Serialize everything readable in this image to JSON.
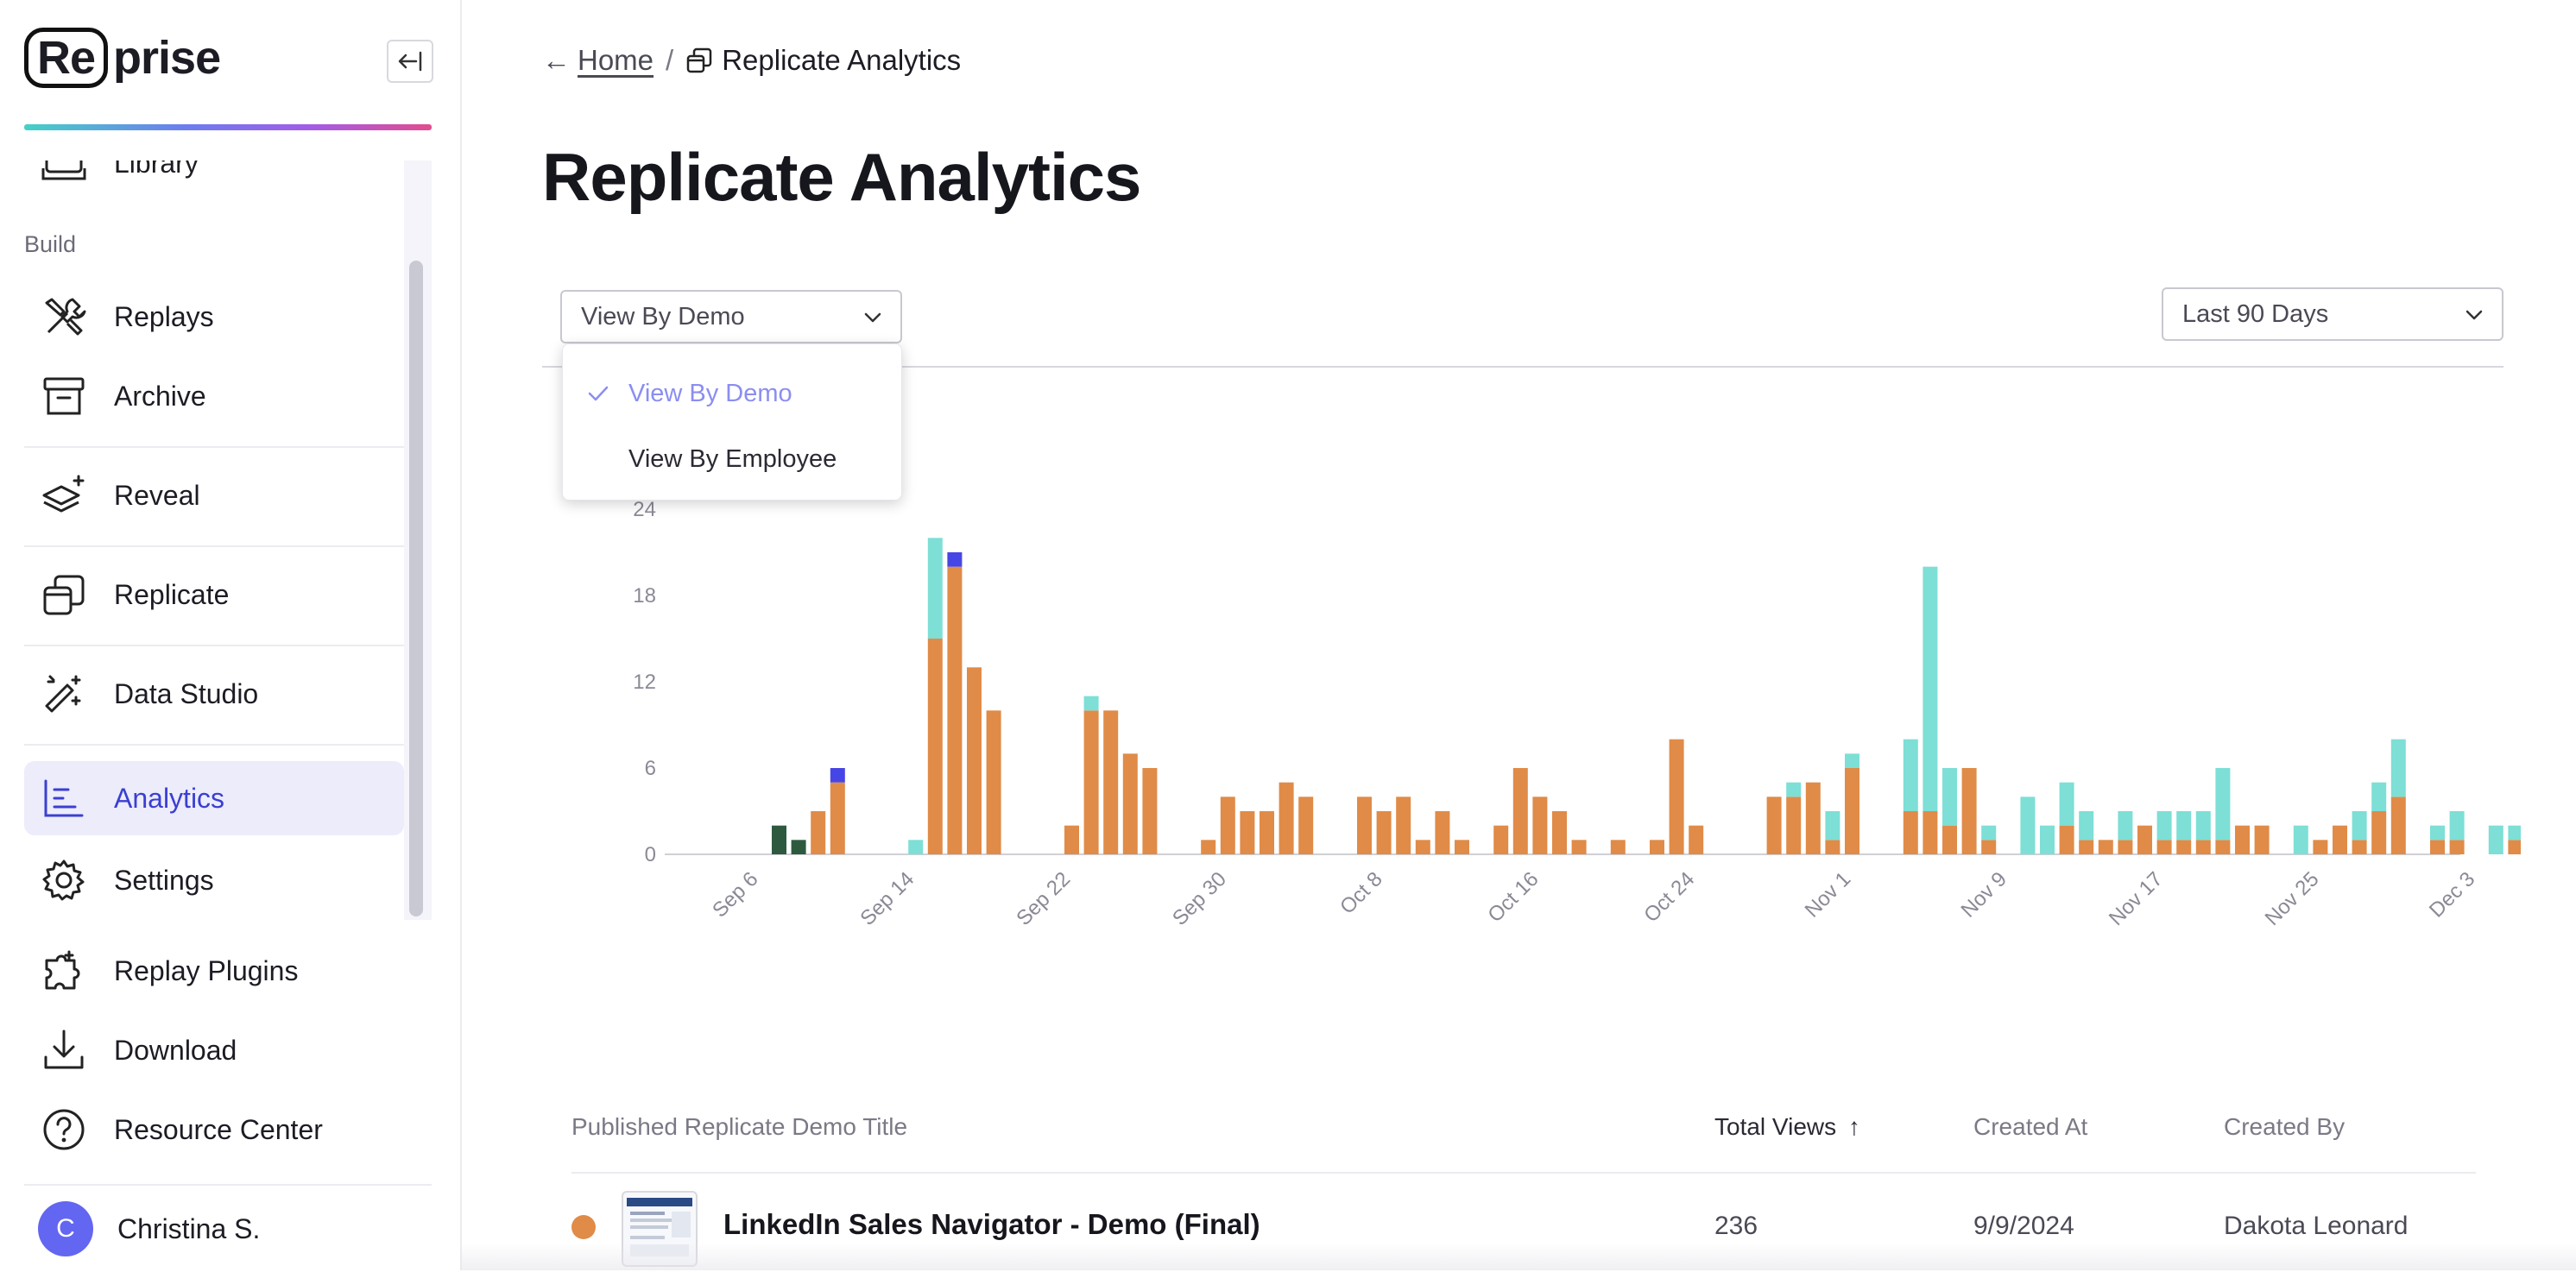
{
  "brand": {
    "logo_left": "Re",
    "logo_right": "prise"
  },
  "sidebar": {
    "partial_top_item": "Library",
    "section_build": "Build",
    "items": [
      {
        "label": "Replays",
        "icon": "tools-icon"
      },
      {
        "label": "Archive",
        "icon": "archive-icon"
      },
      {
        "label": "Reveal",
        "icon": "layers-sparkle-icon"
      },
      {
        "label": "Replicate",
        "icon": "copy-windows-icon"
      },
      {
        "label": "Data Studio",
        "icon": "magic-wand-icon"
      },
      {
        "label": "Analytics",
        "icon": "chart-icon",
        "active": true
      }
    ],
    "lower_items": [
      {
        "label": "Settings",
        "icon": "gear-icon"
      },
      {
        "label": "Replay Plugins",
        "icon": "puzzle-icon"
      },
      {
        "label": "Download",
        "icon": "download-icon"
      },
      {
        "label": "Resource Center",
        "icon": "help-circle-icon"
      }
    ],
    "user": {
      "initial": "C",
      "name": "Christina S."
    }
  },
  "breadcrumb": {
    "back_arrow": "←",
    "home": "Home",
    "separator": "/",
    "current": "Replicate Analytics"
  },
  "page_title": "Replicate Analytics",
  "filters": {
    "view_select": "View By Demo",
    "range_select": "Last 90 Days",
    "dropdown_options": [
      {
        "label": "View By Demo",
        "selected": true
      },
      {
        "label": "View By Employee",
        "selected": false
      }
    ]
  },
  "colors": {
    "orange": "#e08b48",
    "teal": "#7ddfd6",
    "dark_green": "#2d5a3f",
    "blue": "#4646e6",
    "accent": "#3b3fd1"
  },
  "chart_data": {
    "type": "bar",
    "stacked": true,
    "x_axis": "date",
    "x_ticks": [
      "Sep 6",
      "Sep 14",
      "Sep 22",
      "Sep 30",
      "Oct 8",
      "Oct 16",
      "Oct 24",
      "Nov 1",
      "Nov 9",
      "Nov 17",
      "Nov 25",
      "Dec 3"
    ],
    "y_ticks": [
      0,
      6,
      12,
      18,
      24
    ],
    "ylim": [
      0,
      24
    ],
    "start_date": "Sep 6",
    "series": [
      {
        "color": "#2d5a3f",
        "points": [
          [
            10,
            2
          ],
          [
            11,
            1
          ]
        ]
      },
      {
        "color": "#e08b48",
        "points": [
          [
            12,
            3
          ],
          [
            13,
            5
          ],
          [
            18,
            15
          ],
          [
            19,
            20
          ],
          [
            20,
            13
          ],
          [
            21,
            10
          ],
          [
            25,
            2
          ],
          [
            26,
            10
          ],
          [
            27,
            10
          ],
          [
            28,
            7
          ],
          [
            29,
            6
          ],
          [
            32,
            1
          ],
          [
            33,
            4
          ],
          [
            34,
            3
          ],
          [
            35,
            3
          ],
          [
            36,
            5
          ],
          [
            37,
            4
          ],
          [
            40,
            4
          ],
          [
            41,
            3
          ],
          [
            42,
            4
          ],
          [
            43,
            1
          ],
          [
            44,
            3
          ],
          [
            45,
            1
          ],
          [
            47,
            2
          ],
          [
            48,
            6
          ],
          [
            49,
            4
          ],
          [
            50,
            3
          ],
          [
            51,
            1
          ],
          [
            53,
            1
          ],
          [
            55,
            1
          ],
          [
            56,
            8
          ],
          [
            57,
            2
          ],
          [
            61,
            4
          ],
          [
            62,
            4
          ],
          [
            63,
            5
          ],
          [
            64,
            1
          ],
          [
            65,
            6
          ],
          [
            68,
            3
          ],
          [
            69,
            3
          ],
          [
            70,
            2
          ],
          [
            71,
            6
          ],
          [
            72,
            1
          ],
          [
            76,
            2
          ],
          [
            77,
            1
          ],
          [
            78,
            1
          ],
          [
            79,
            1
          ],
          [
            80,
            2
          ],
          [
            81,
            1
          ],
          [
            82,
            1
          ],
          [
            83,
            1
          ],
          [
            84,
            1
          ],
          [
            85,
            2
          ],
          [
            86,
            2
          ],
          [
            89,
            1
          ],
          [
            90,
            2
          ],
          [
            91,
            1
          ],
          [
            92,
            3
          ],
          [
            93,
            4
          ],
          [
            95,
            1
          ],
          [
            96,
            1
          ],
          [
            99,
            1
          ],
          [
            101,
            4
          ],
          [
            102,
            1
          ],
          [
            103,
            2
          ]
        ]
      },
      {
        "color": "#7ddfd6",
        "points": [
          [
            17,
            1
          ],
          [
            18,
            7
          ],
          [
            26,
            1
          ],
          [
            62,
            1
          ],
          [
            64,
            2
          ],
          [
            65,
            1
          ],
          [
            68,
            5
          ],
          [
            69,
            17
          ],
          [
            70,
            4
          ],
          [
            72,
            1
          ],
          [
            74,
            4
          ],
          [
            75,
            2
          ],
          [
            76,
            3
          ],
          [
            77,
            2
          ],
          [
            79,
            2
          ],
          [
            81,
            2
          ],
          [
            82,
            2
          ],
          [
            83,
            2
          ],
          [
            84,
            5
          ],
          [
            88,
            2
          ],
          [
            91,
            2
          ],
          [
            92,
            2
          ],
          [
            93,
            4
          ],
          [
            95,
            1
          ],
          [
            96,
            2
          ],
          [
            98,
            2
          ],
          [
            99,
            1
          ],
          [
            100,
            2
          ],
          [
            101,
            1
          ]
        ]
      },
      {
        "color": "#4646e6",
        "points": [
          [
            13,
            1
          ],
          [
            19,
            1
          ]
        ]
      }
    ]
  },
  "table": {
    "headers": {
      "title": "Published Replicate Demo Title",
      "views": "Total Views",
      "created_at": "Created At",
      "created_by": "Created By"
    },
    "sort_indicator": "↑",
    "rows": [
      {
        "title": "LinkedIn Sales Navigator - Demo (Final)",
        "views": "236",
        "created_at": "9/9/2024",
        "created_by": "Dakota Leonard"
      }
    ]
  }
}
